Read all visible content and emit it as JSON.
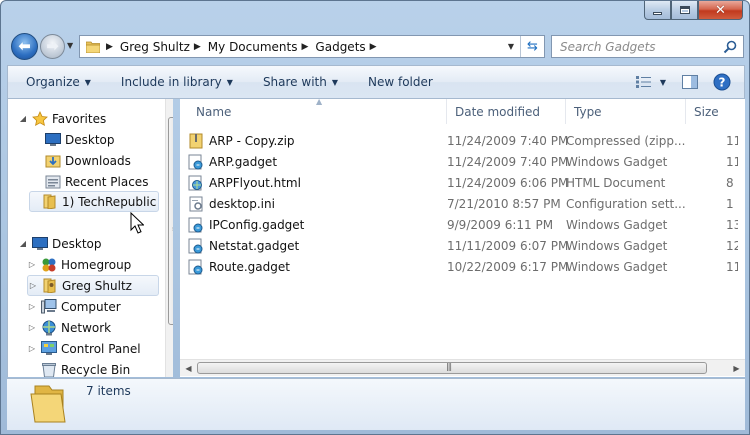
{
  "address": {
    "crumbs": [
      "Greg Shultz",
      "My Documents",
      "Gadgets"
    ]
  },
  "search": {
    "placeholder": "Search Gadgets"
  },
  "command_bar": {
    "organize": "Organize",
    "include_in_library": "Include in library",
    "share_with": "Share with",
    "new_folder": "New folder"
  },
  "nav": {
    "favorites": "Favorites",
    "desktop_fav": "Desktop",
    "downloads": "Downloads",
    "recent_places": "Recent Places",
    "techrepublic": "1) TechRepublic",
    "desktop": "Desktop",
    "homegroup": "Homegroup",
    "greg_shultz": "Greg Shultz",
    "computer": "Computer",
    "network": "Network",
    "control_panel": "Control Panel",
    "recycle_bin": "Recycle Bin"
  },
  "columns": {
    "name": "Name",
    "date_modified": "Date modified",
    "type": "Type",
    "size": "Size"
  },
  "files": [
    {
      "name": "ARP - Copy.zip",
      "date": "11/24/2009 7:40 PM",
      "type": "Compressed (zipp...",
      "size": "11",
      "icon": "zip-folder-icon"
    },
    {
      "name": "ARP.gadget",
      "date": "11/24/2009 7:40 PM",
      "type": "Windows Gadget",
      "size": "11",
      "icon": "gadget-icon"
    },
    {
      "name": "ARPFlyout.html",
      "date": "11/24/2009 6:06 PM",
      "type": "HTML Document",
      "size": "8",
      "icon": "html-icon"
    },
    {
      "name": "desktop.ini",
      "date": "7/21/2010 8:57 PM",
      "type": "Configuration sett...",
      "size": "1",
      "icon": "ini-file-icon"
    },
    {
      "name": "IPConfig.gadget",
      "date": "9/9/2009 6:11 PM",
      "type": "Windows Gadget",
      "size": "13",
      "icon": "gadget-icon"
    },
    {
      "name": "Netstat.gadget",
      "date": "11/11/2009 6:07 PM",
      "type": "Windows Gadget",
      "size": "12",
      "icon": "gadget-icon"
    },
    {
      "name": "Route.gadget",
      "date": "10/22/2009 6:17 PM",
      "type": "Windows Gadget",
      "size": "11",
      "icon": "gadget-icon"
    }
  ],
  "details": {
    "item_count": "7 items"
  }
}
